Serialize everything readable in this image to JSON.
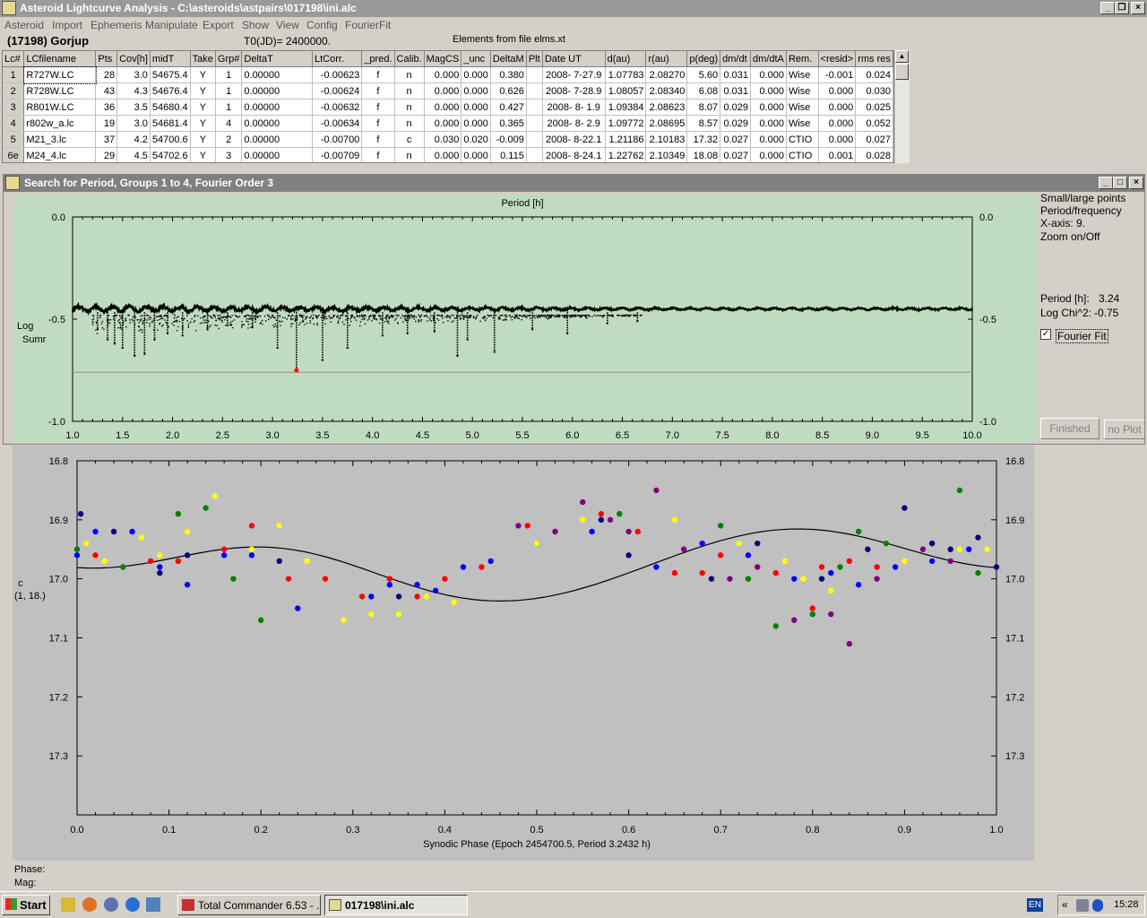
{
  "window": {
    "title": "Asteroid Lightcurve Analysis - C:\\asteroids\\astpairs\\017198\\ini.alc"
  },
  "menu": [
    "Asteroid",
    "Import",
    "Ephemeris",
    "Manipulate",
    "Export",
    "Show",
    "View",
    "Config",
    "FourierFit"
  ],
  "header": {
    "object": "(17198) Gorjup",
    "t0": "T0(JD)= 2400000.",
    "elements": "Elements from file elms.xt"
  },
  "table": {
    "columns": [
      "Lc#",
      "LCfilename",
      "Pts",
      "Cov[h]",
      "midT",
      "Take",
      "Grp#",
      "DeltaT",
      "LtCorr.",
      "_pred.",
      "Calib.",
      "MagCS",
      "_unc",
      "DeltaM",
      "Plt",
      "Date UT",
      "d(au)",
      "r(au)",
      "p(deg)",
      "dm/dt",
      "dm/dtA",
      "Rem.",
      "<resid>",
      "rms res"
    ],
    "rows": [
      [
        "1",
        "R727W.LC",
        "28",
        "3.0",
        "54675.4",
        "Y",
        "1",
        "0.00000",
        "-0.00623",
        "f",
        "n",
        "0.000",
        "0.000",
        "0.380",
        "",
        "2008- 7-27.9",
        "1.07783",
        "2.08270",
        "5.60",
        "0.031",
        "0.000",
        "Wise",
        "-0.001",
        "0.024"
      ],
      [
        "2",
        "R728W.LC",
        "43",
        "4.3",
        "54676.4",
        "Y",
        "1",
        "0.00000",
        "-0.00624",
        "f",
        "n",
        "0.000",
        "0.000",
        "0.626",
        "",
        "2008- 7-28.9",
        "1.08057",
        "2.08340",
        "6.08",
        "0.031",
        "0.000",
        "Wise",
        "0.000",
        "0.030"
      ],
      [
        "3",
        "R801W.LC",
        "36",
        "3.5",
        "54680.4",
        "Y",
        "1",
        "0.00000",
        "-0.00632",
        "f",
        "n",
        "0.000",
        "0.000",
        "0.427",
        "",
        "2008- 8- 1.9",
        "1.09384",
        "2.08623",
        "8.07",
        "0.029",
        "0.000",
        "Wise",
        "0.000",
        "0.025"
      ],
      [
        "4",
        "r802w_a.lc",
        "19",
        "3.0",
        "54681.4",
        "Y",
        "4",
        "0.00000",
        "-0.00634",
        "f",
        "n",
        "0.000",
        "0.000",
        "0.365",
        "",
        "2008- 8- 2.9",
        "1.09772",
        "2.08695",
        "8.57",
        "0.029",
        "0.000",
        "Wise",
        "0.000",
        "0.052"
      ],
      [
        "5",
        "M21_3.lc",
        "37",
        "4.2",
        "54700.6",
        "Y",
        "2",
        "0.00000",
        "-0.00700",
        "f",
        "c",
        "0.030",
        "0.020",
        "-0.009",
        "",
        "2008- 8-22.1",
        "1.21186",
        "2.10183",
        "17.32",
        "0.027",
        "0.000",
        "CTIO",
        "0.000",
        "0.027"
      ],
      [
        "6e",
        "M24_4.lc",
        "29",
        "4.5",
        "54702.6",
        "Y",
        "3",
        "0.00000",
        "-0.00709",
        "f",
        "n",
        "0.000",
        "0.000",
        "0.115",
        "",
        "2008- 8-24.1",
        "1.22762",
        "2.10349",
        "18.08",
        "0.027",
        "0.000",
        "CTIO",
        "0.001",
        "0.028"
      ]
    ]
  },
  "period_window": {
    "title": "Search for Period, Groups 1 to 4, Fourier Order 3",
    "side": [
      "Small/large points",
      "Period/frequency",
      "X-axis: 9.",
      "Zoom on/Off"
    ],
    "period_label": "Period [h]:",
    "period_value": "3.24",
    "chi_label": "Log Chi^2:",
    "chi_value": "-0.75",
    "fourier_checkbox": "Fourier Fit",
    "fourier_checked": true,
    "btn_finished": "Finished",
    "btn_noplot": "no Plot"
  },
  "chart_data": [
    {
      "type": "scatter",
      "title": "Period [h]",
      "ylabel": "Log Sumr",
      "xlabel": "",
      "xlim": [
        1.0,
        10.0
      ],
      "ylim": [
        -1.0,
        0.0
      ],
      "xticks": [
        "1.0",
        "1.5",
        "2.0",
        "2.5",
        "3.0",
        "3.5",
        "4.0",
        "4.5",
        "5.0",
        "5.5",
        "6.0",
        "6.5",
        "7.0",
        "7.5",
        "8.0",
        "8.5",
        "9.0",
        "9.5",
        "10.0"
      ],
      "yticks": [
        "0.0",
        "-0.5",
        "-1.0"
      ],
      "baseline": -0.45,
      "threshold_line": -0.76,
      "best": {
        "x": 3.24,
        "y": -0.75
      },
      "dips": [
        [
          1.25,
          -0.55
        ],
        [
          1.35,
          -0.6
        ],
        [
          1.42,
          -0.62
        ],
        [
          1.5,
          -0.64
        ],
        [
          1.62,
          -0.68
        ],
        [
          1.72,
          -0.67
        ],
        [
          1.82,
          -0.6
        ],
        [
          1.95,
          -0.57
        ],
        [
          2.1,
          -0.58
        ],
        [
          2.35,
          -0.55
        ],
        [
          2.55,
          -0.53
        ],
        [
          2.8,
          -0.54
        ],
        [
          3.05,
          -0.64
        ],
        [
          3.24,
          -0.75
        ],
        [
          3.5,
          -0.7
        ],
        [
          3.75,
          -0.64
        ],
        [
          4.1,
          -0.58
        ],
        [
          4.35,
          -0.57
        ],
        [
          4.62,
          -0.56
        ],
        [
          4.85,
          -0.68
        ],
        [
          4.95,
          -0.6
        ],
        [
          5.22,
          -0.66
        ],
        [
          5.6,
          -0.55
        ],
        [
          5.95,
          -0.57
        ],
        [
          6.35,
          -0.52
        ],
        [
          6.65,
          -0.51
        ]
      ]
    },
    {
      "type": "scatter",
      "title": "",
      "xlabel": "Synodic Phase (Epoch 2454700.5, Period 3.2432 h)",
      "ylabel": "c (1, 18.)",
      "xlim": [
        0.0,
        1.0
      ],
      "ylim": [
        16.8,
        17.4
      ],
      "xticks": [
        "0.0",
        "0.1",
        "0.2",
        "0.3",
        "0.4",
        "0.5",
        "0.6",
        "0.7",
        "0.8",
        "0.9",
        "1.0"
      ],
      "yticks": [
        "16.8",
        "16.9",
        "17.0",
        "17.1",
        "17.2",
        "17.3"
      ],
      "fit": {
        "mean": 16.972,
        "terms": [
          [
            -0.03,
            0.02
          ],
          [
            0.035,
            -0.005
          ],
          [
            0.004,
            0.002
          ]
        ]
      },
      "series": [
        {
          "color": "#0000ff",
          "points": [
            [
              0.0,
              16.96
            ],
            [
              0.02,
              16.92
            ],
            [
              0.06,
              16.92
            ],
            [
              0.09,
              16.98
            ],
            [
              0.12,
              17.01
            ],
            [
              0.16,
              16.96
            ],
            [
              0.19,
              16.96
            ],
            [
              0.24,
              17.05
            ],
            [
              0.32,
              17.03
            ],
            [
              0.34,
              17.01
            ],
            [
              0.37,
              17.01
            ],
            [
              0.39,
              17.02
            ],
            [
              0.42,
              16.98
            ],
            [
              0.45,
              16.97
            ],
            [
              0.5,
              16.94
            ],
            [
              0.56,
              16.92
            ],
            [
              0.63,
              16.98
            ],
            [
              0.68,
              16.94
            ],
            [
              0.73,
              16.96
            ],
            [
              0.78,
              17.0
            ],
            [
              0.82,
              16.99
            ],
            [
              0.85,
              17.01
            ],
            [
              0.89,
              16.98
            ],
            [
              0.93,
              16.97
            ],
            [
              0.97,
              16.95
            ]
          ]
        },
        {
          "color": "#ff0000",
          "points": [
            [
              0.02,
              16.96
            ],
            [
              0.08,
              16.97
            ],
            [
              0.11,
              16.97
            ],
            [
              0.16,
              16.95
            ],
            [
              0.19,
              16.91
            ],
            [
              0.23,
              17.0
            ],
            [
              0.27,
              17.0
            ],
            [
              0.31,
              17.03
            ],
            [
              0.34,
              17.0
            ],
            [
              0.37,
              17.03
            ],
            [
              0.4,
              17.0
            ],
            [
              0.44,
              16.98
            ],
            [
              0.49,
              16.91
            ],
            [
              0.57,
              16.89
            ],
            [
              0.61,
              16.92
            ],
            [
              0.65,
              16.99
            ],
            [
              0.68,
              16.99
            ],
            [
              0.7,
              16.96
            ],
            [
              0.76,
              16.99
            ],
            [
              0.8,
              17.05
            ],
            [
              0.81,
              16.98
            ],
            [
              0.84,
              16.97
            ],
            [
              0.87,
              16.98
            ]
          ]
        },
        {
          "color": "#ffff00",
          "points": [
            [
              0.01,
              16.94
            ],
            [
              0.03,
              16.97
            ],
            [
              0.07,
              16.93
            ],
            [
              0.09,
              16.96
            ],
            [
              0.12,
              16.92
            ],
            [
              0.15,
              16.86
            ],
            [
              0.19,
              16.95
            ],
            [
              0.22,
              16.91
            ],
            [
              0.25,
              16.97
            ],
            [
              0.29,
              17.07
            ],
            [
              0.32,
              17.06
            ],
            [
              0.35,
              17.06
            ],
            [
              0.38,
              17.03
            ],
            [
              0.41,
              17.04
            ],
            [
              0.5,
              16.94
            ],
            [
              0.55,
              16.9
            ],
            [
              0.6,
              16.92
            ],
            [
              0.65,
              16.9
            ],
            [
              0.72,
              16.94
            ],
            [
              0.77,
              16.97
            ],
            [
              0.79,
              17.0
            ],
            [
              0.82,
              17.02
            ],
            [
              0.86,
              16.95
            ],
            [
              0.9,
              16.97
            ],
            [
              0.96,
              16.95
            ],
            [
              0.99,
              16.95
            ]
          ]
        },
        {
          "color": "#008000",
          "points": [
            [
              0.0,
              16.95
            ],
            [
              0.05,
              16.98
            ],
            [
              0.11,
              16.89
            ],
            [
              0.14,
              16.88
            ],
            [
              0.17,
              17.0
            ],
            [
              0.2,
              17.07
            ],
            [
              0.52,
              16.92
            ],
            [
              0.59,
              16.89
            ],
            [
              0.7,
              16.91
            ],
            [
              0.73,
              17.0
            ],
            [
              0.76,
              17.08
            ],
            [
              0.8,
              17.06
            ],
            [
              0.83,
              16.98
            ],
            [
              0.85,
              16.92
            ],
            [
              0.88,
              16.94
            ],
            [
              0.96,
              16.85
            ],
            [
              0.98,
              16.99
            ]
          ]
        },
        {
          "color": "#000080",
          "points": [
            [
              0.004,
              16.89
            ],
            [
              0.04,
              16.92
            ],
            [
              0.09,
              16.99
            ],
            [
              0.12,
              16.96
            ],
            [
              0.22,
              16.97
            ],
            [
              0.35,
              17.03
            ],
            [
              0.57,
              16.9
            ],
            [
              0.6,
              16.96
            ],
            [
              0.69,
              17.0
            ],
            [
              0.74,
              16.94
            ],
            [
              0.81,
              17.0
            ],
            [
              0.86,
              16.95
            ],
            [
              0.9,
              16.88
            ],
            [
              0.93,
              16.94
            ],
            [
              0.95,
              16.95
            ],
            [
              0.98,
              16.93
            ],
            [
              1.0,
              16.98
            ]
          ]
        },
        {
          "color": "#800080",
          "points": [
            [
              0.48,
              16.91
            ],
            [
              0.52,
              16.92
            ],
            [
              0.55,
              16.87
            ],
            [
              0.58,
              16.9
            ],
            [
              0.6,
              16.92
            ],
            [
              0.63,
              16.85
            ],
            [
              0.66,
              16.95
            ],
            [
              0.71,
              17.0
            ],
            [
              0.74,
              16.98
            ],
            [
              0.78,
              17.07
            ],
            [
              0.82,
              17.06
            ],
            [
              0.84,
              17.11
            ],
            [
              0.87,
              17.0
            ],
            [
              0.92,
              16.95
            ],
            [
              0.95,
              16.97
            ]
          ]
        }
      ]
    }
  ],
  "status": {
    "phase_label": "Phase:",
    "mag_label": "Mag:"
  },
  "taskbar": {
    "start": "Start",
    "tasks": [
      "Total Commander 6.53 - ...",
      "017198\\ini.alc"
    ],
    "lang": "EN",
    "clock": "15:28"
  }
}
